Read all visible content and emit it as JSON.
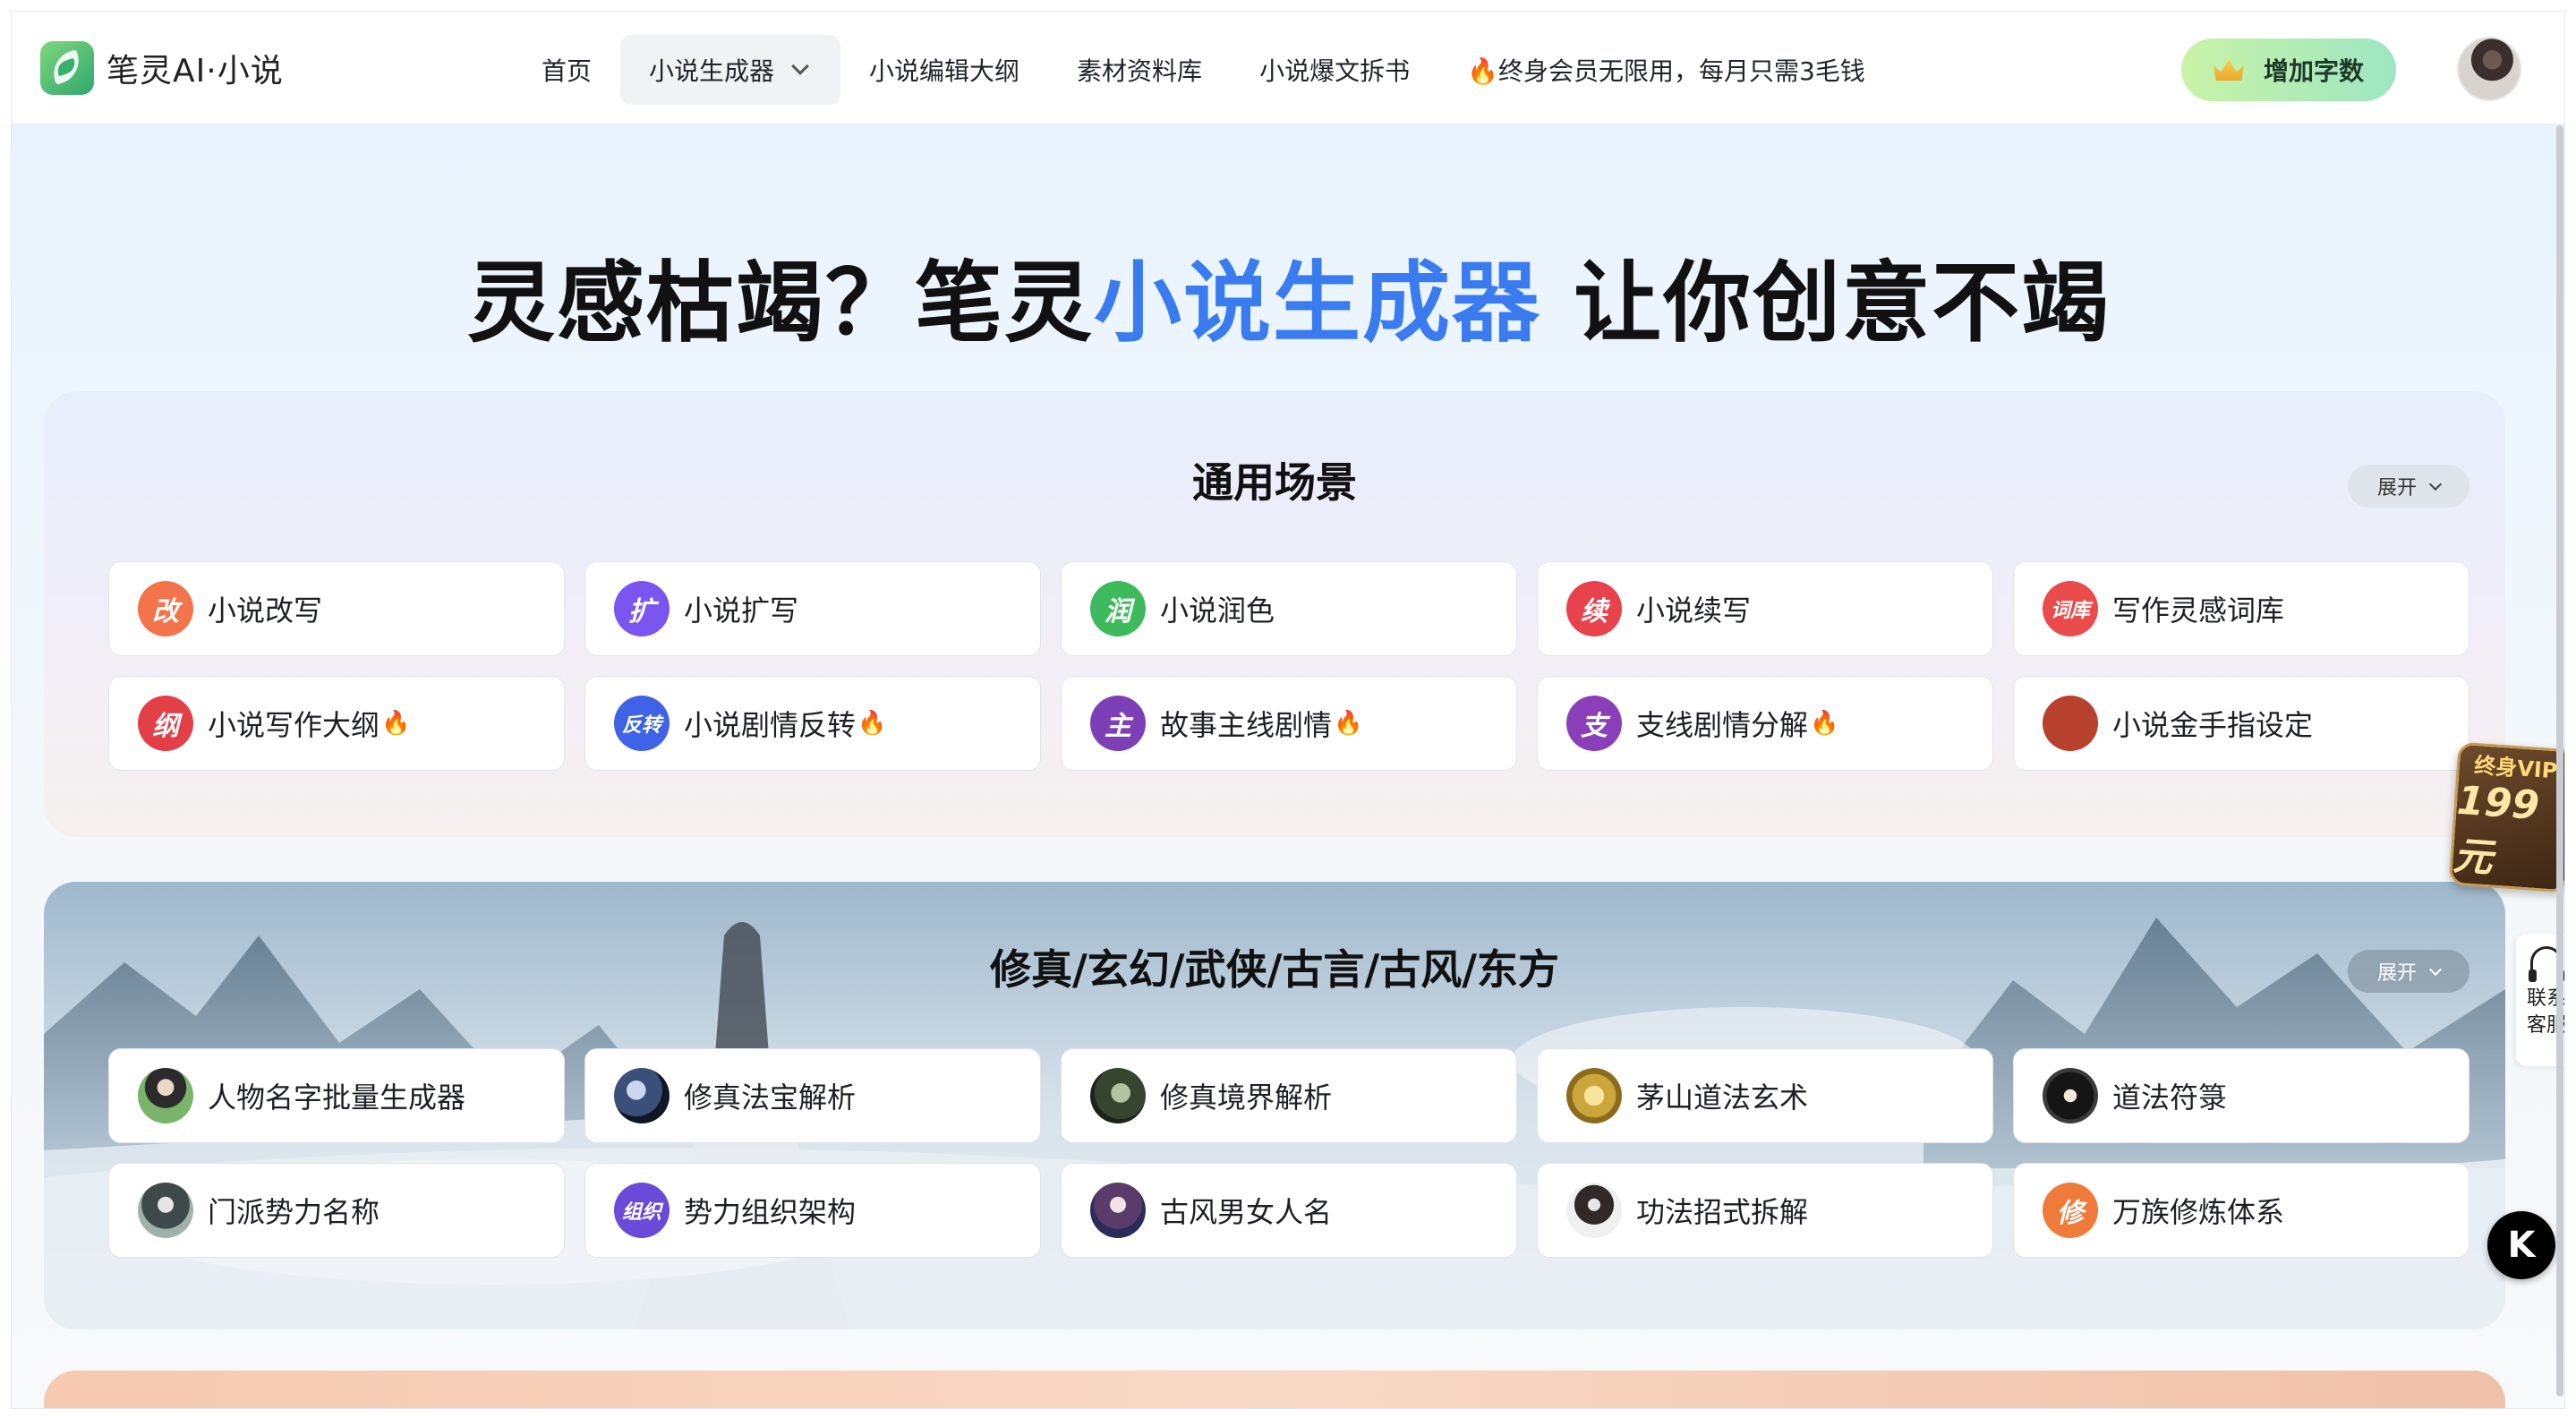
{
  "app": {
    "logo_text": "笔灵AI·小说"
  },
  "nav": {
    "items": [
      {
        "label": "首页"
      },
      {
        "label": "小说生成器",
        "active": true
      },
      {
        "label": "小说编辑大纲"
      },
      {
        "label": "素材资料库"
      },
      {
        "label": "小说爆文拆书"
      },
      {
        "label": "🔥终身会员无限用，每月只需3毛钱"
      }
    ],
    "add_words": "增加字数"
  },
  "hero": {
    "prefix": "灵感枯竭？笔灵",
    "highlight": "小说生成器",
    "suffix": " 让你创意不竭"
  },
  "sections": [
    {
      "title": "通用场景",
      "expand": "展开",
      "cards": [
        {
          "label": "小说改写",
          "icon_text": "改",
          "color": "#f3734a",
          "hot": false
        },
        {
          "label": "小说扩写",
          "icon_text": "扩",
          "color": "#7b55f0",
          "hot": false
        },
        {
          "label": "小说润色",
          "icon_text": "润",
          "color": "#3dbb5c",
          "hot": false
        },
        {
          "label": "小说续写",
          "icon_text": "续",
          "color": "#e8424c",
          "hot": false
        },
        {
          "label": "写作灵感词库",
          "icon_text": "词库",
          "color": "#ea4b4b",
          "hot": false
        },
        {
          "label": "小说写作大纲",
          "icon_text": "纲",
          "color": "#e23f48",
          "hot": true
        },
        {
          "label": "小说剧情反转",
          "icon_text": "反转",
          "color": "#3f63e6",
          "hot": true
        },
        {
          "label": "故事主线剧情",
          "icon_text": "主",
          "color": "#7d3fb6",
          "hot": true
        },
        {
          "label": "支线剧情分解",
          "icon_text": "支",
          "color": "#8a3fb8",
          "hot": true
        },
        {
          "label": "小说金手指设定",
          "icon_text": "",
          "color": "#b8412e",
          "hot": false
        }
      ]
    },
    {
      "title": "修真/玄幻/武侠/古言/古风/东方",
      "expand": "展开",
      "cards": [
        {
          "label": "人物名字批量生成器",
          "icon_text": "",
          "photo": "ph-1"
        },
        {
          "label": "修真法宝解析",
          "icon_text": "",
          "photo": "ph-2"
        },
        {
          "label": "修真境界解析",
          "icon_text": "",
          "photo": "ph-3"
        },
        {
          "label": "茅山道法玄术",
          "icon_text": "",
          "photo": "ph-4"
        },
        {
          "label": "道法符箓",
          "icon_text": "",
          "photo": "ph-5"
        },
        {
          "label": "门派势力名称",
          "icon_text": "",
          "photo": "ph-6"
        },
        {
          "label": "势力组织架构",
          "icon_text": "组织",
          "color": "#6a4ad8"
        },
        {
          "label": "古风男女人名",
          "icon_text": "",
          "photo": "ph-7"
        },
        {
          "label": "功法招式拆解",
          "icon_text": "",
          "photo": "ph-8"
        },
        {
          "label": "万族修炼体系",
          "icon_text": "修",
          "color": "#f07a3a"
        }
      ]
    }
  ],
  "fire_glyph": "🔥",
  "side": {
    "vip_top": "终身VIP",
    "vip_price": "199元",
    "service_label": "联系客服",
    "k_label": "K"
  }
}
